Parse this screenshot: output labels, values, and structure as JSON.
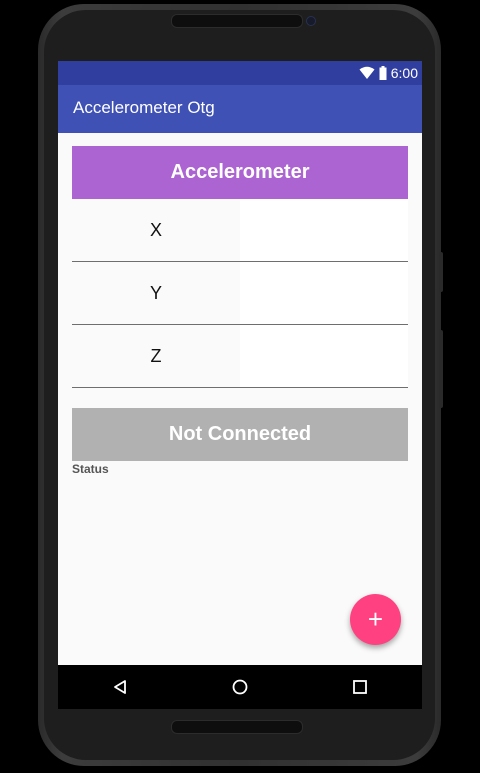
{
  "status_bar": {
    "time": "6:00",
    "icons": [
      "wifi-icon",
      "battery-icon"
    ]
  },
  "app_bar": {
    "title": "Accelerometer Otg"
  },
  "sensor_card": {
    "title": "Accelerometer"
  },
  "axes": [
    {
      "label": "X",
      "value": ""
    },
    {
      "label": "Y",
      "value": ""
    },
    {
      "label": "Z",
      "value": ""
    }
  ],
  "connection": {
    "button_label": "Not Connected",
    "status_label": "Status"
  },
  "fab": {
    "icon": "plus-icon",
    "symbol": "+"
  },
  "nav_bar": {
    "icons": [
      "back-icon",
      "home-icon",
      "recents-icon"
    ]
  },
  "colors": {
    "status_bar": "#303f9f",
    "app_bar": "#3f51b5",
    "sensor_card": "#ab64d1",
    "connection_button": "#b1b1b1",
    "fab": "#ff4081"
  }
}
